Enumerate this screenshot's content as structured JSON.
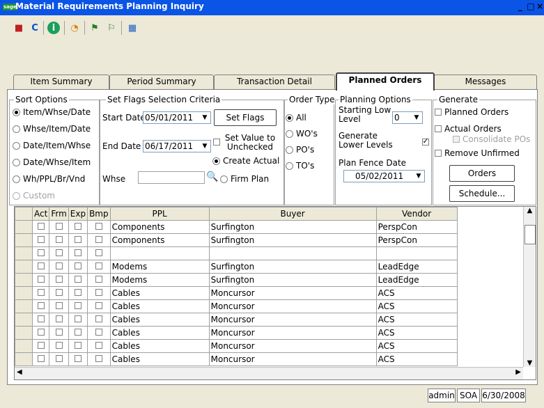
{
  "window": {
    "logo": "sage",
    "title": "Material Requirements Planning Inquiry",
    "minimize": "_",
    "restore": "□",
    "close": "×"
  },
  "toolbar": {
    "icons": [
      "bookmark-icon",
      "refresh-icon",
      "help-icon",
      "chart-icon",
      "flag-icon",
      "flag-alt-icon",
      "report-icon"
    ]
  },
  "tabs": [
    "Item Summary",
    "Period Summary",
    "Transaction Detail",
    "Planned Orders",
    "Messages"
  ],
  "sort_options": {
    "title": "Sort Options",
    "items": [
      "Item/Whse/Date",
      "Whse/Item/Date",
      "Date/Item/Whse",
      "Date/Whse/Item",
      "Wh/PPL/Br/Vnd",
      "Custom"
    ],
    "selected": 0
  },
  "flags": {
    "title": "Set Flags Selection Criteria",
    "start_label": "Start Date",
    "start_value": "05/01/2011",
    "end_label": "End Date",
    "end_value": "06/17/2011",
    "whse_label": "Whse",
    "whse_value": "",
    "set_flags": "Set Flags",
    "set_value_label": "Set Value to Unchecked",
    "create_actual": "Create Actual",
    "firm_plan": "Firm Plan"
  },
  "order_type": {
    "title": "Order Type",
    "items": [
      "All",
      "WO's",
      "PO's",
      "TO's"
    ],
    "selected": 0
  },
  "planning": {
    "title": "Planning Options",
    "starting_low_label": "Starting Low Level",
    "starting_low_value": "0",
    "generate_lower_label": "Generate Lower Levels",
    "plan_fence_label": "Plan Fence Date",
    "plan_fence_value": "05/02/2011"
  },
  "generate": {
    "title": "Generate",
    "planned_orders": "Planned Orders",
    "actual_orders": "Actual Orders",
    "consolidate_pos": "Consolidate POs",
    "remove_unfirmed": "Remove Unfirmed",
    "orders_btn": "Orders",
    "schedule_btn": "Schedule..."
  },
  "grid": {
    "columns": [
      "Act",
      "Frm",
      "Exp",
      "Bmp",
      "PPL",
      "Buyer",
      "Vendor"
    ],
    "rows": [
      {
        "ppl": "Components",
        "buyer": "Surfington",
        "vendor": "PerspCon"
      },
      {
        "ppl": "Components",
        "buyer": "Surfington",
        "vendor": "PerspCon"
      },
      {
        "ppl": "",
        "buyer": "",
        "vendor": ""
      },
      {
        "ppl": "Modems",
        "buyer": "Surfington",
        "vendor": "LeadEdge"
      },
      {
        "ppl": "Modems",
        "buyer": "Surfington",
        "vendor": "LeadEdge"
      },
      {
        "ppl": "Cables",
        "buyer": "Moncursor",
        "vendor": "ACS"
      },
      {
        "ppl": "Cables",
        "buyer": "Moncursor",
        "vendor": "ACS"
      },
      {
        "ppl": "Cables",
        "buyer": "Moncursor",
        "vendor": "ACS"
      },
      {
        "ppl": "Cables",
        "buyer": "Moncursor",
        "vendor": "ACS"
      },
      {
        "ppl": "Cables",
        "buyer": "Moncursor",
        "vendor": "ACS"
      },
      {
        "ppl": "Cables",
        "buyer": "Moncursor",
        "vendor": "ACS"
      }
    ]
  },
  "status": {
    "user": "admin",
    "company": "SOA",
    "date": "6/30/2008"
  }
}
